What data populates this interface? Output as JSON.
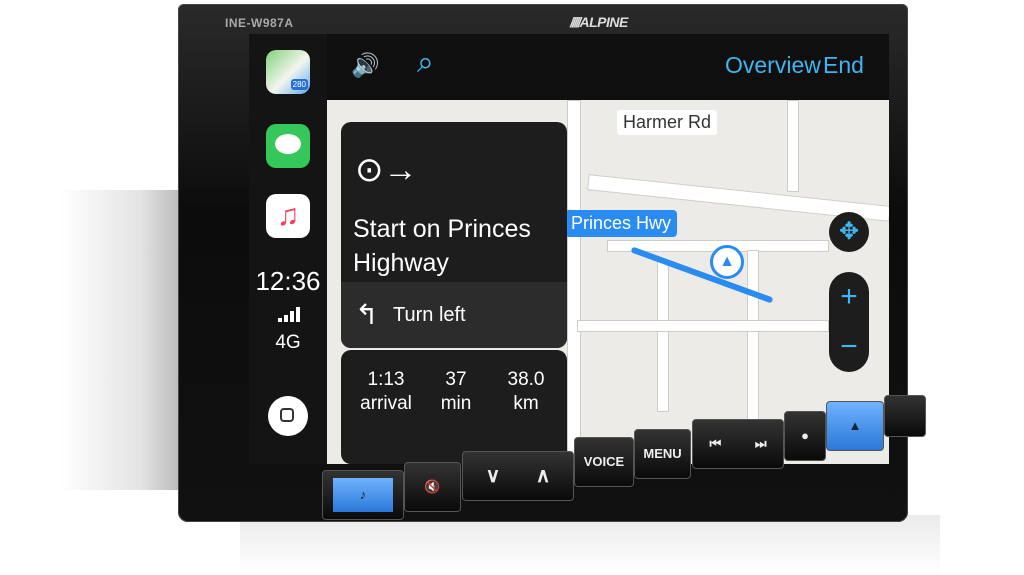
{
  "device": {
    "model": "INE-W987A",
    "brand": "ALPINE"
  },
  "sidebar": {
    "apps": [
      {
        "name": "Maps",
        "icon": "maps-icon",
        "badge": "280"
      },
      {
        "name": "Messages",
        "icon": "messages-icon"
      },
      {
        "name": "Music",
        "icon": "music-icon",
        "glyph": "♫"
      }
    ],
    "time": "12:36",
    "network": "4G",
    "signal_bars": 4
  },
  "topbar": {
    "volume_icon": "🔊",
    "search_icon": "⌕",
    "overview": "Overview",
    "end": "End"
  },
  "map": {
    "street_label": "Harmer Rd",
    "route_label": "Princes Hwy"
  },
  "nav_card": {
    "maneuver_icon": "⊙→",
    "instruction": "Start on Princes Highway",
    "next_icon": "↰",
    "next": "Turn left"
  },
  "trip": {
    "arrival_value": "1:13",
    "arrival_label": "arrival",
    "min_value": "37",
    "min_label": "min",
    "km_value": "38.0",
    "km_label": "km"
  },
  "map_controls": {
    "pan": "✥",
    "zoom_in": "+",
    "zoom_out": "−"
  },
  "hard_buttons": {
    "music": "♪",
    "mute": "🔇",
    "down": "∨",
    "up": "∧",
    "voice": "VOICE",
    "menu": "MENU",
    "prev": "⏮",
    "next": "⏭",
    "nav": "▲"
  },
  "colors": {
    "accent": "#3fb6f0",
    "route": "#2a8cf0",
    "button_glow": "#4b9af0"
  }
}
